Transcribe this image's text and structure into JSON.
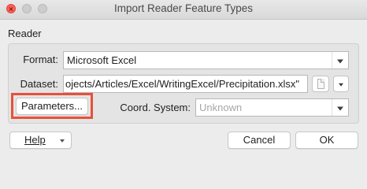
{
  "window": {
    "title": "Import Reader Feature Types"
  },
  "reader_group": {
    "label": "Reader",
    "format_label": "Format:",
    "format_value": "Microsoft Excel",
    "dataset_label": "Dataset:",
    "dataset_value": "ojects/Articles/Excel/WritingExcel/Precipitation.xlsx\"",
    "parameters_label": "Parameters...",
    "coord_system_label": "Coord. System:",
    "coord_system_value": "Unknown"
  },
  "footer": {
    "help_label": "Help",
    "cancel_label": "Cancel",
    "ok_label": "OK"
  },
  "colors": {
    "highlight": "#e8503a",
    "close_button": "#fc5f57"
  },
  "icons": [
    "close-icon",
    "minimize-icon",
    "maximize-icon",
    "chevron-down-icon",
    "file-icon"
  ]
}
